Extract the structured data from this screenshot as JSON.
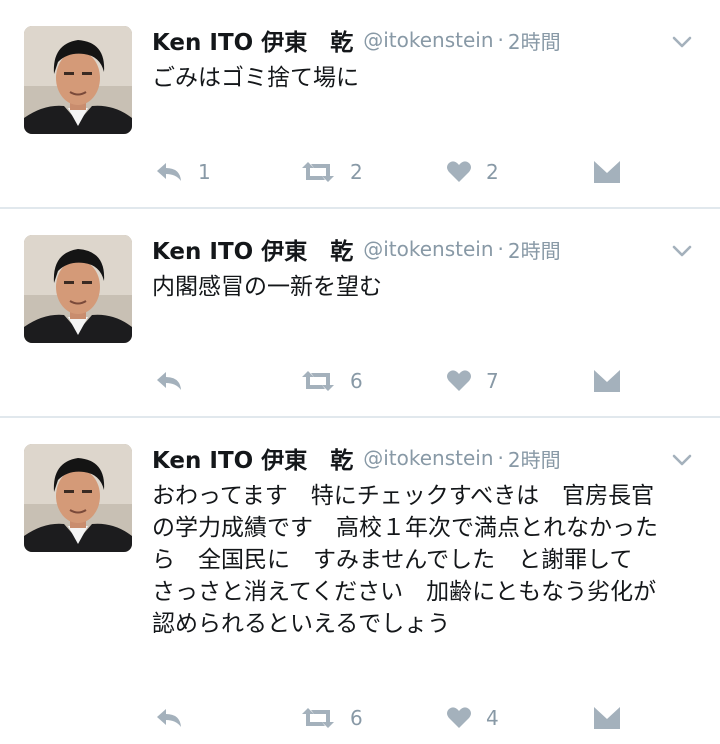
{
  "tweets": [
    {
      "author_name": "Ken ITO 伊東　乾",
      "handle": "@itokenstein",
      "separator": "·",
      "time": "2時間",
      "text": "ごみはゴミ捨て場に",
      "reply_count": "1",
      "retweet_count": "2",
      "like_count": "2"
    },
    {
      "author_name": "Ken ITO 伊東　乾",
      "handle": "@itokenstein",
      "separator": "·",
      "time": "2時間",
      "text": "内閣感冒の一新を望む",
      "reply_count": "",
      "retweet_count": "6",
      "like_count": "7"
    },
    {
      "author_name": "Ken ITO 伊東　乾",
      "handle": "@itokenstein",
      "separator": "·",
      "time": "2時間",
      "text": "おわってます　特にチェックすべきは　官房長官の学力成績です　高校１年次で満点とれなかったら　全国民に　すみませんでした　と謝罪して　さっさと消えてください　加齢にともなう劣化が認められるといえるでしょう",
      "reply_count": "",
      "retweet_count": "6",
      "like_count": "4"
    }
  ],
  "icons": {
    "reply": "reply-icon",
    "retweet": "retweet-icon",
    "like": "heart-icon",
    "dm": "direct-message-icon",
    "menu": "chevron-down-icon"
  },
  "colors": {
    "icon_gray": "#a4b1bc",
    "meta_gray": "#8899a6",
    "text": "#14171a",
    "divider": "#e1e8ed"
  }
}
